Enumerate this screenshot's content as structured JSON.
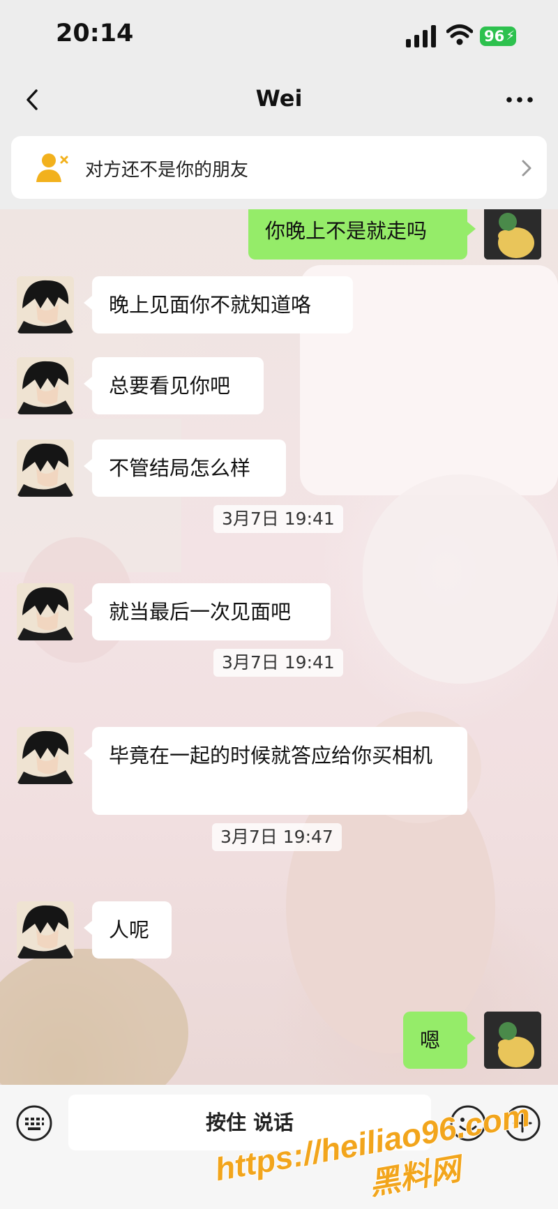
{
  "status_bar": {
    "time": "20:14",
    "battery": "96"
  },
  "nav": {
    "title": "Wei"
  },
  "banner": {
    "text": "对方还不是你的朋友"
  },
  "messages": [
    {
      "side": "out",
      "text": "你晚上不是就走吗"
    },
    {
      "side": "in",
      "text": "晚上见面你不就知道咯"
    },
    {
      "side": "in",
      "text": "总要看见你吧"
    },
    {
      "side": "in",
      "text": "不管结局怎么样"
    },
    {
      "timestamp": "3月7日 19:41"
    },
    {
      "side": "in",
      "text": "就当最后一次见面吧"
    },
    {
      "timestamp": "3月7日 19:41"
    },
    {
      "side": "in",
      "text": "毕竟在一起的时候就答应给你买相机"
    },
    {
      "timestamp": "3月7日 19:47"
    },
    {
      "side": "in",
      "text": "人呢"
    },
    {
      "side": "out",
      "text": "嗯"
    }
  ],
  "input": {
    "hold_to_talk": "按住 说话"
  },
  "watermark": {
    "url": "https://heiliao96.com",
    "name": "黑料网"
  },
  "colors": {
    "outgoing": "#95ec69",
    "incoming": "#ffffff",
    "background": "#ededed",
    "battery": "#2dc14e"
  },
  "icons": [
    "signal-icon",
    "wifi-icon",
    "battery-icon",
    "back-icon",
    "more-icon",
    "user-x-icon",
    "chevron-right-icon",
    "keyboard-icon",
    "emoji-icon",
    "plus-icon"
  ]
}
